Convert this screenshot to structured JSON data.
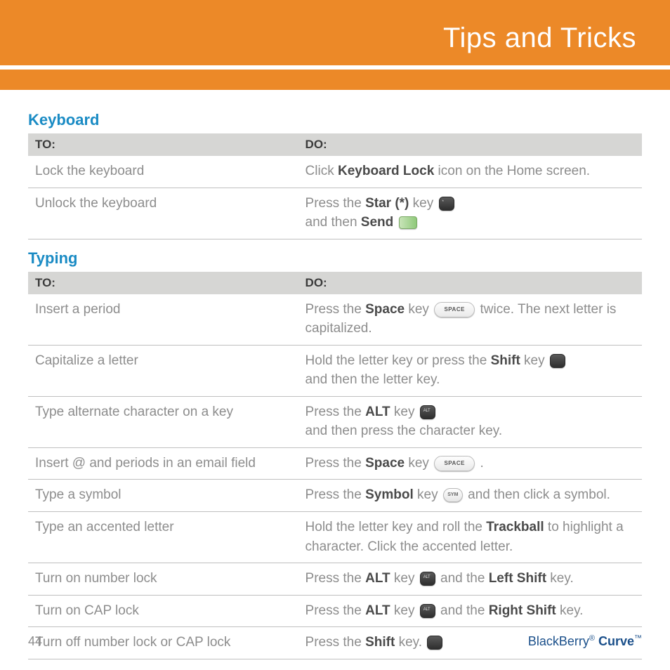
{
  "header": {
    "title": "Tips and Tricks"
  },
  "sections": {
    "keyboard": {
      "heading": "Keyboard",
      "th_to": "TO:",
      "th_do": "DO:",
      "rows": {
        "r0": {
          "to": "Lock the keyboard",
          "do_a": "Click ",
          "do_b": "Keyboard Lock",
          "do_c": " icon on the Home screen."
        },
        "r1": {
          "to": "Unlock the keyboard",
          "do_a": "Press the ",
          "do_b": "Star (*)",
          "do_c": " key ",
          "do_d": "and then ",
          "do_e": "Send"
        }
      }
    },
    "typing": {
      "heading": "Typing",
      "th_to": "TO:",
      "th_do": "DO:",
      "rows": {
        "r0": {
          "to": "Insert a period",
          "a": "Press the ",
          "b": "Space",
          "c": " key ",
          "d": "twice. The next letter is capitalized."
        },
        "r1": {
          "to": "Capitalize a letter",
          "a": "Hold the letter key or press the ",
          "b": "Shift",
          "c": " key ",
          "d": "and then the letter key."
        },
        "r2": {
          "to": "Type alternate character on a key",
          "a": "Press the ",
          "b": "ALT",
          "c": " key ",
          "d": "and then press the character key."
        },
        "r3": {
          "to": "Insert @ and periods in an email field",
          "a": "Press the ",
          "b": "Space",
          "c": " key ",
          "d": " ."
        },
        "r4": {
          "to": "Type a symbol",
          "a": "Press the ",
          "b": "Symbol",
          "c": " key ",
          "d": " and then click a symbol."
        },
        "r5": {
          "to": "Type an accented letter",
          "a": "Hold the letter key and roll the ",
          "b": "Trackball",
          "c": " to highlight a character. Click the accented letter."
        },
        "r6": {
          "to": "Turn on number lock",
          "a": "Press the ",
          "b": "ALT",
          "c": " key ",
          "d": " and the ",
          "e": "Left Shift",
          "f": " key."
        },
        "r7": {
          "to": "Turn on CAP lock",
          "a": "Press the ",
          "b": "ALT",
          "c": " key ",
          "d": " and the ",
          "e": "Right Shift",
          "f": " key."
        },
        "r8": {
          "to": "Turn off number lock or CAP lock",
          "a": "Press the ",
          "b": "Shift",
          "c": " key. "
        }
      }
    }
  },
  "footer": {
    "page": "44",
    "brand_a": "BlackBerry",
    "brand_b": "Curve"
  },
  "icons": {
    "space_label": "SPACE",
    "sym_label": "SYM"
  }
}
